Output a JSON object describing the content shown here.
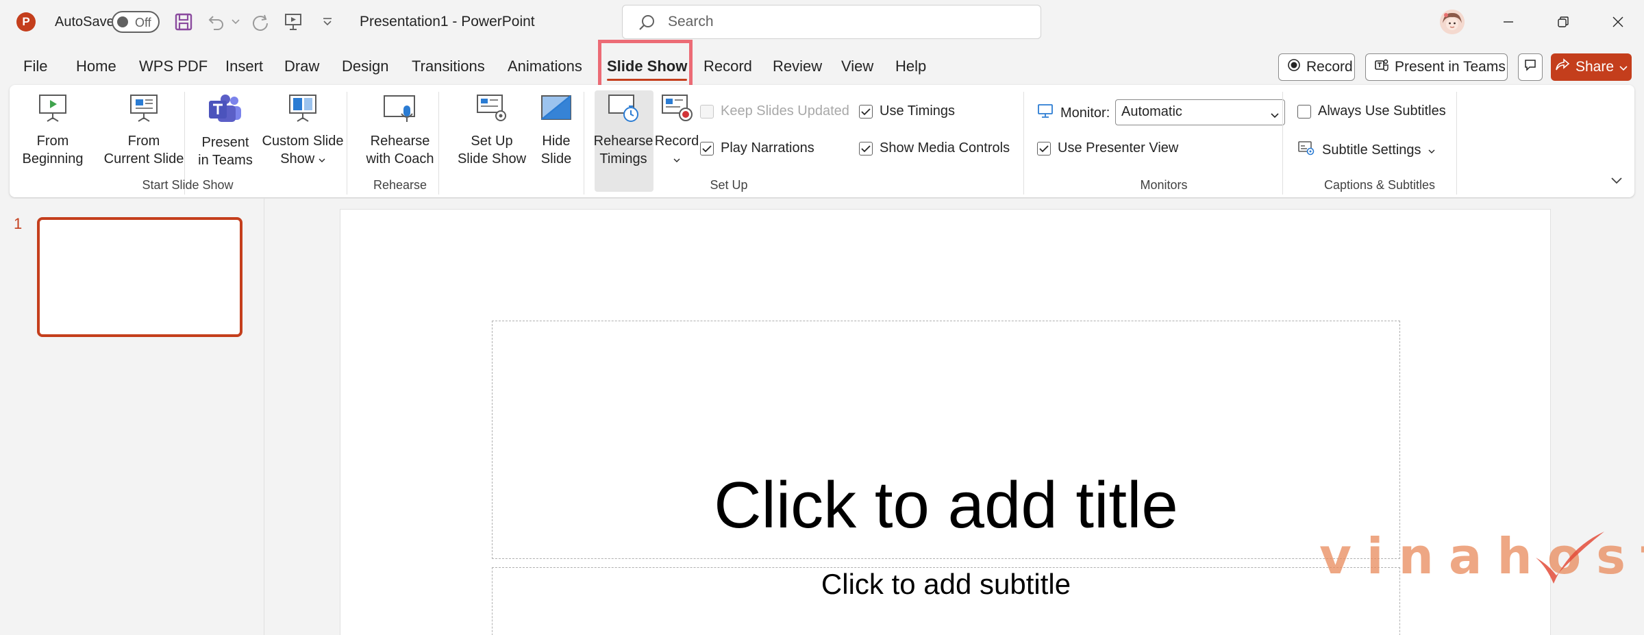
{
  "titlebar": {
    "app_letter": "P",
    "autosave_label": "AutoSave",
    "autosave_state": "Off",
    "document_title": "Presentation1  -  PowerPoint",
    "search_placeholder": "Search"
  },
  "tabs": [
    {
      "label": "File"
    },
    {
      "label": "Home"
    },
    {
      "label": "WPS PDF"
    },
    {
      "label": "Insert"
    },
    {
      "label": "Draw"
    },
    {
      "label": "Design"
    },
    {
      "label": "Transitions"
    },
    {
      "label": "Animations"
    },
    {
      "label": "Slide Show",
      "active": true
    },
    {
      "label": "Record"
    },
    {
      "label": "Review"
    },
    {
      "label": "View"
    },
    {
      "label": "Help"
    }
  ],
  "top_right": {
    "record_label": "Record",
    "present_teams_label": "Present in Teams",
    "share_label": "Share"
  },
  "ribbon": {
    "start_slide_show": {
      "group_label": "Start Slide Show",
      "from_beginning": [
        "From",
        "Beginning"
      ],
      "from_current": [
        "From",
        "Current Slide"
      ],
      "present_teams": [
        "Present",
        "in Teams"
      ],
      "custom_show": [
        "Custom Slide",
        "Show"
      ]
    },
    "rehearse": {
      "group_label": "Rehearse",
      "rehearse_coach": [
        "Rehearse",
        "with Coach"
      ]
    },
    "set_up": {
      "group_label": "Set Up",
      "set_up_show": [
        "Set Up",
        "Slide Show"
      ],
      "hide_slide": [
        "Hide",
        "Slide"
      ],
      "rehearse_timings": [
        "Rehearse",
        "Timings"
      ],
      "record": "Record",
      "keep_slides_updated": {
        "label": "Keep Slides Updated",
        "checked": false,
        "disabled": true
      },
      "play_narrations": {
        "label": "Play Narrations",
        "checked": true
      },
      "use_timings": {
        "label": "Use Timings",
        "checked": true
      },
      "show_media_controls": {
        "label": "Show Media Controls",
        "checked": true
      }
    },
    "monitors": {
      "group_label": "Monitors",
      "monitor_label": "Monitor:",
      "monitor_value": "Automatic",
      "presenter_view": {
        "label": "Use Presenter View",
        "checked": true
      }
    },
    "captions": {
      "group_label": "Captions & Subtitles",
      "always_subtitles": {
        "label": "Always Use Subtitles",
        "checked": false
      },
      "subtitle_settings": "Subtitle Settings"
    }
  },
  "slides_panel": {
    "slide_number": "1"
  },
  "slide": {
    "title_placeholder": "Click to add title",
    "subtitle_placeholder": "Click to add subtitle"
  },
  "watermark": "vinahost.",
  "colors": {
    "accent": "#c43e1c",
    "highlight_box": "#ec6b75",
    "teams_purple": "#5b5fc7"
  }
}
